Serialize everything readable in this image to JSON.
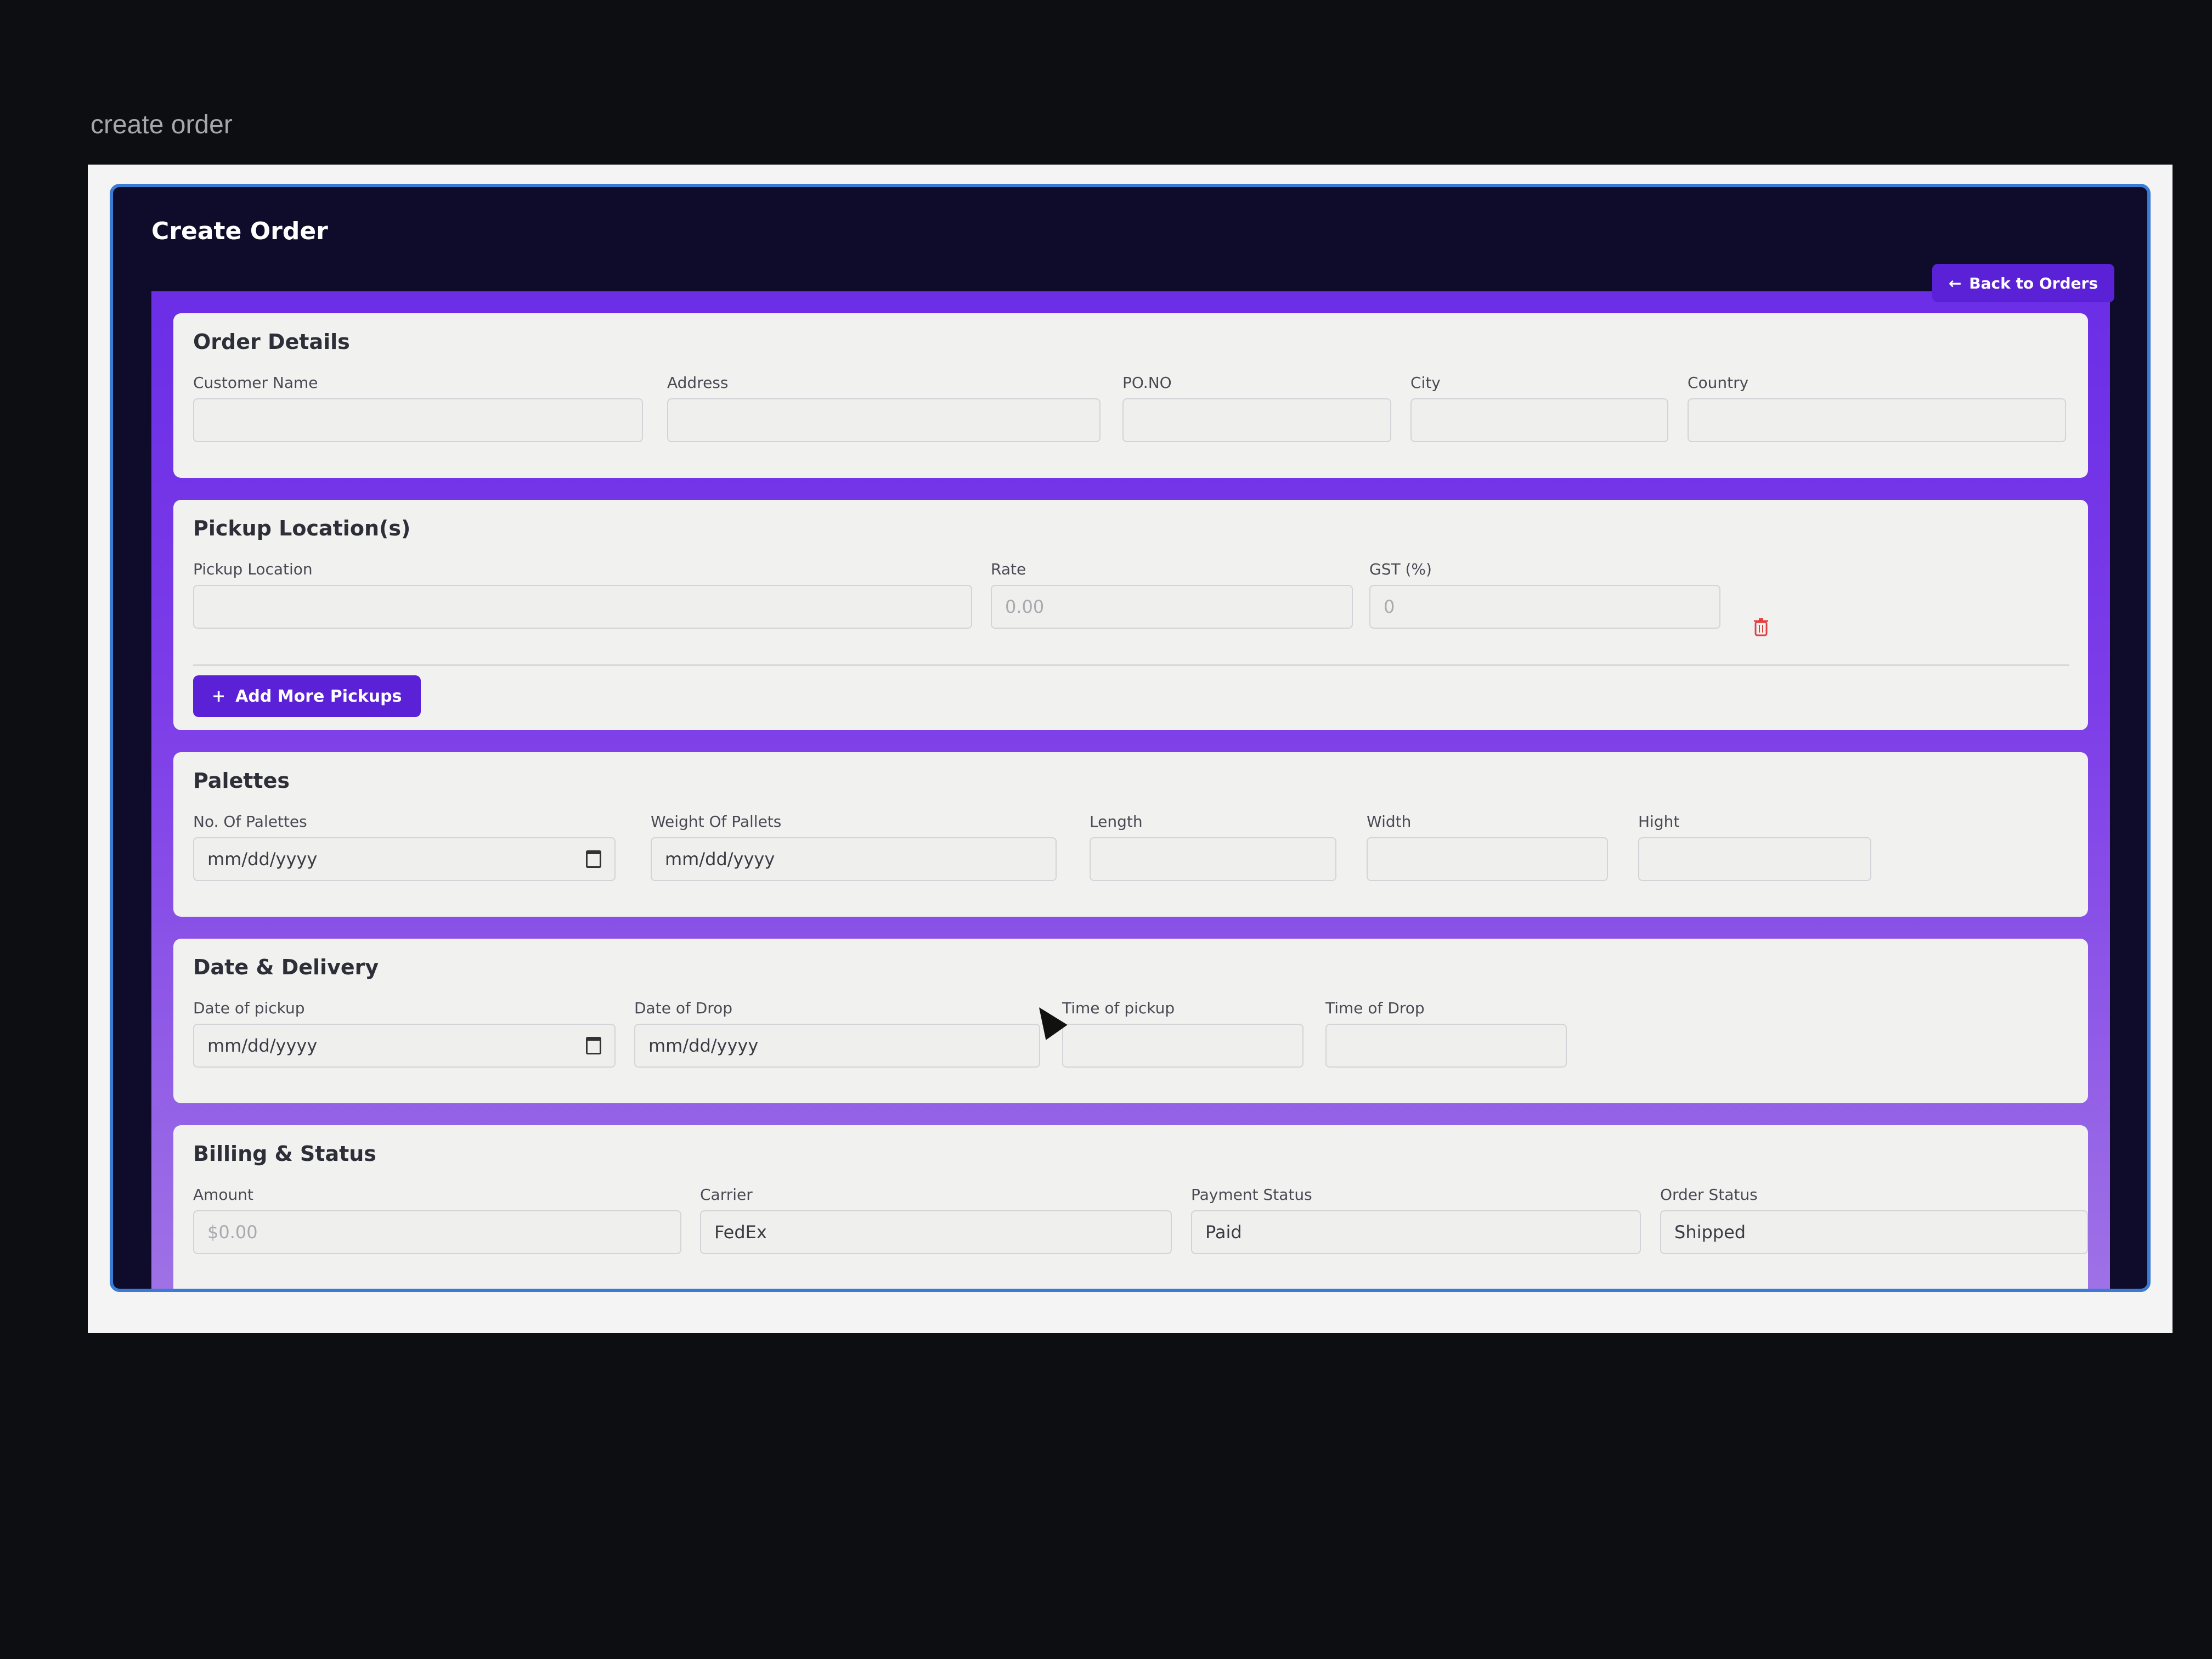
{
  "screen_caption": "create order",
  "header": {
    "title": "Create Order",
    "back_button": "Back to Orders"
  },
  "order_details": {
    "title": "Order Details",
    "customer_name": {
      "label": "Customer Name",
      "value": ""
    },
    "address": {
      "label": "Address",
      "value": ""
    },
    "po_no": {
      "label": "PO.NO",
      "value": ""
    },
    "city": {
      "label": "City",
      "value": ""
    },
    "country": {
      "label": "Country",
      "value": ""
    }
  },
  "pickup": {
    "title": "Pickup Location(s)",
    "location": {
      "label": "Pickup Location",
      "value": ""
    },
    "rate": {
      "label": "Rate",
      "placeholder": "0.00"
    },
    "gst": {
      "label": "GST (%)",
      "placeholder": "0"
    },
    "add_button": "Add More Pickups"
  },
  "palettes": {
    "title": "Palettes",
    "count": {
      "label": "No. Of Palettes",
      "value": "mm/dd/yyyy"
    },
    "weight": {
      "label": "Weight Of Pallets",
      "value": "mm/dd/yyyy"
    },
    "length": {
      "label": "Length",
      "value": ""
    },
    "width": {
      "label": "Width",
      "value": ""
    },
    "height": {
      "label": "Hight",
      "value": ""
    }
  },
  "delivery": {
    "title": "Date & Delivery",
    "pickup_date": {
      "label": "Date of pickup",
      "value": "mm/dd/yyyy"
    },
    "drop_date": {
      "label": "Date of Drop",
      "value": "mm/dd/yyyy"
    },
    "pickup_time": {
      "label": "Time of pickup",
      "value": ""
    },
    "drop_time": {
      "label": "Time of Drop",
      "value": ""
    }
  },
  "billing": {
    "title": "Billing & Status",
    "amount": {
      "label": "Amount",
      "placeholder": "$0.00"
    },
    "carrier": {
      "label": "Carrier",
      "value": "FedEx"
    },
    "payment_status": {
      "label": "Payment Status",
      "value": "Paid"
    },
    "order_status": {
      "label": "Order Status",
      "value": "Shipped"
    }
  },
  "colors": {
    "accent": "#5b21d6",
    "panel": "#0e0b2b",
    "delete": "#e53e3e"
  }
}
